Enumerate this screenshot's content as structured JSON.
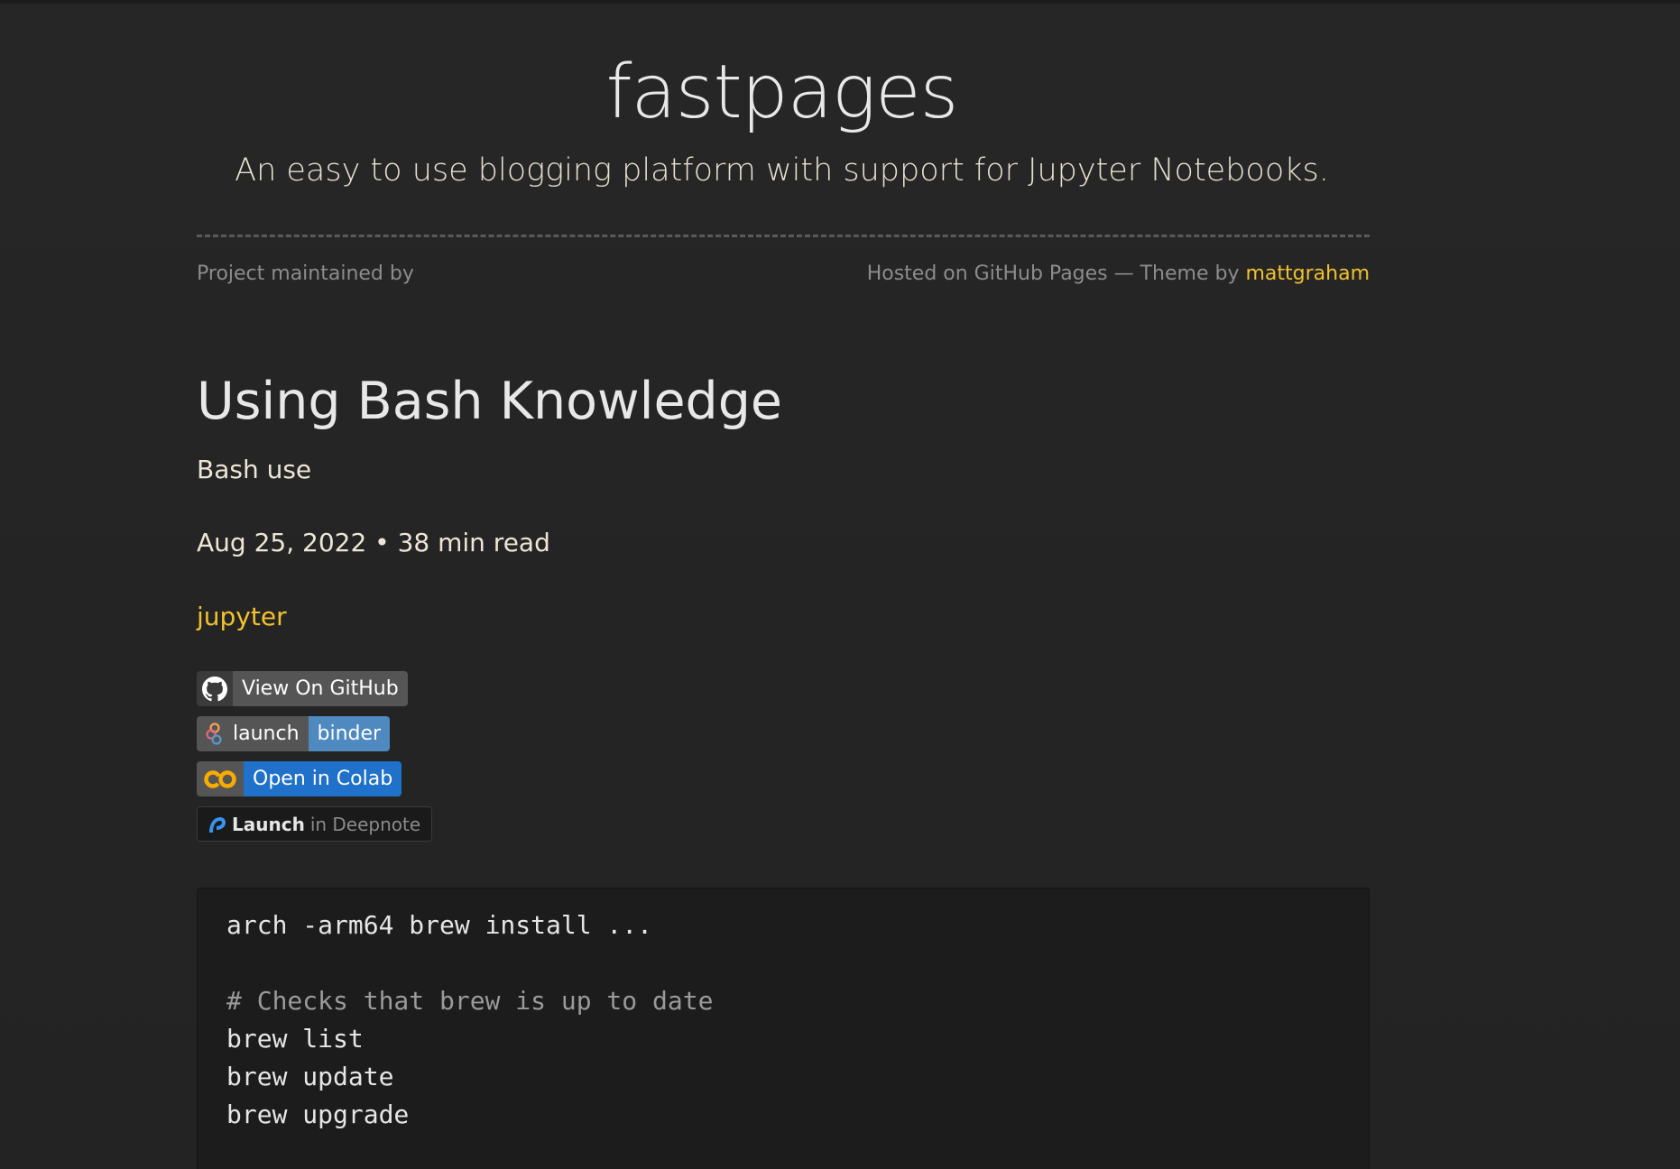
{
  "header": {
    "site_title": "fastpages",
    "site_subtitle": "An easy to use blogging platform with support for Jupyter Notebooks.",
    "maintained_by": "Project maintained by",
    "hosted_text": "Hosted on GitHub Pages — Theme by",
    "theme_author": "mattgraham"
  },
  "post": {
    "title": "Using Bash Knowledge",
    "description": "Bash use",
    "meta": "Aug 25, 2022 • 38 min read",
    "tag": "jupyter"
  },
  "badges": {
    "github": {
      "icon": "github-icon",
      "label": "View On GitHub"
    },
    "binder": {
      "icon": "binder-icon",
      "left": "launch",
      "right": "binder"
    },
    "colab": {
      "icon": "colab-icon",
      "label": "Open in Colab"
    },
    "deepnote": {
      "icon": "deepnote-icon",
      "launch": "Launch",
      "in": "in Deepnote"
    }
  },
  "code": {
    "lines": [
      "arch -arm64 brew install ...",
      "",
      "# Checks that brew is up to date",
      "brew list",
      "brew update",
      "brew upgrade"
    ]
  },
  "colors": {
    "background": "#262626",
    "accent": "#f2c12e",
    "code_background": "#1c1c1c"
  }
}
